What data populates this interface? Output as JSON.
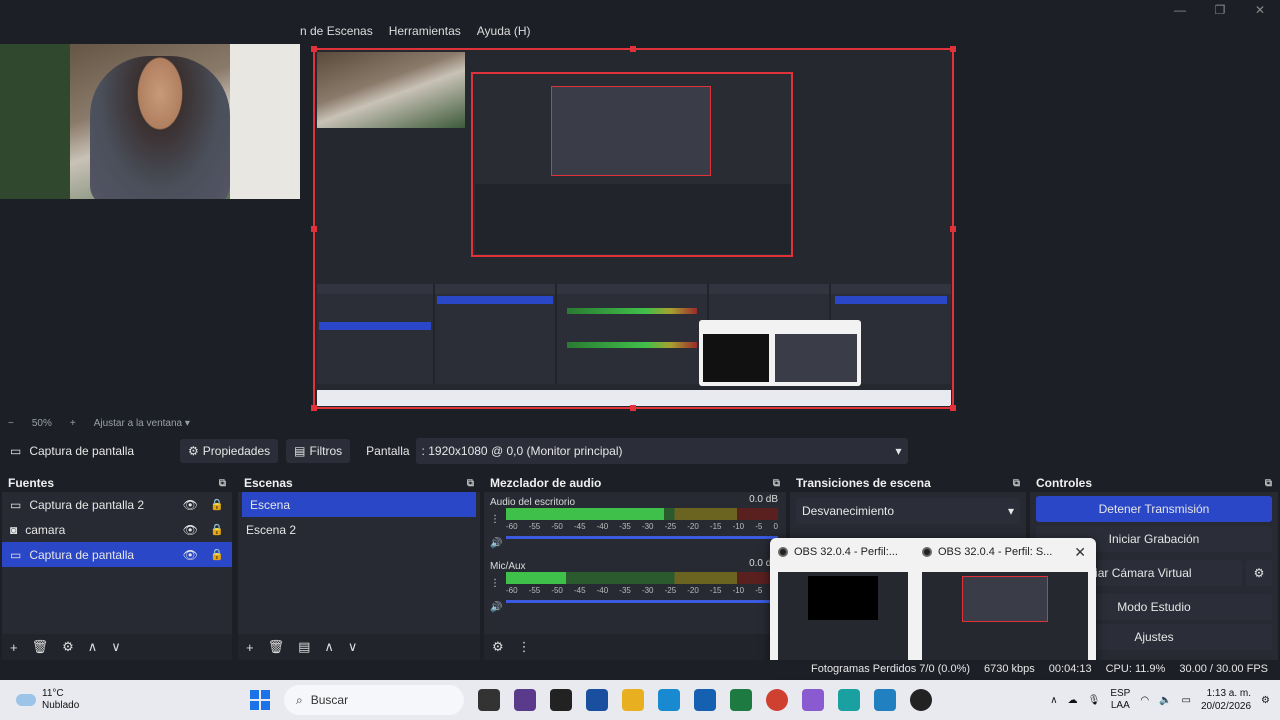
{
  "menu": {
    "items": [
      "n de Escenas",
      "Herramientas",
      "Ayuda (H)"
    ]
  },
  "window": {
    "min": "—",
    "max": "❐",
    "close": "✕"
  },
  "zoom": {
    "minus": "−",
    "value": "50%",
    "plus": "+",
    "fit_label": "Ajustar a la ventana"
  },
  "source_bar": {
    "source_name": "Captura de pantalla",
    "properties": "Propiedades",
    "filters": "Filtros",
    "display_label": "Pantalla",
    "display_value": ": 1920x1080 @ 0,0 (Monitor principal)"
  },
  "sources": {
    "title": "Fuentes",
    "items": [
      {
        "label": "Captura de pantalla 2",
        "icon": "monitor-icon"
      },
      {
        "label": "camara",
        "icon": "camera-icon"
      },
      {
        "label": "Captura de pantalla",
        "icon": "monitor-icon"
      }
    ],
    "selected_index": 2
  },
  "scenes": {
    "title": "Escenas",
    "items": [
      "Escena",
      "Escena 2"
    ],
    "selected_index": 0
  },
  "mixer": {
    "title": "Mezclador de audio",
    "channels": [
      {
        "name": "Audio del escritorio",
        "db": "0.0 dB",
        "level": 0.58
      },
      {
        "name": "Mic/Aux",
        "db": "0.0 dB",
        "level": 0.22
      }
    ],
    "ticks": [
      "-60",
      "-55",
      "-50",
      "-45",
      "-40",
      "-35",
      "-30",
      "-25",
      "-20",
      "-15",
      "-10",
      "-5",
      "0"
    ]
  },
  "transitions": {
    "title": "Transiciones de escena",
    "selected": "Desvanecimiento"
  },
  "controls": {
    "title": "Controles",
    "stop_stream": "Detener Transmisión",
    "start_recording": "Iniciar Grabación",
    "virtual_cam": "iciar Cámara Virtual",
    "studio_mode": "Modo Estudio",
    "settings": "Ajustes"
  },
  "popup": {
    "title1": "OBS 32.0.4 - Perfil:...",
    "title2": "OBS 32.0.4 - Perfil: S..."
  },
  "status": {
    "frames": "Fotogramas Perdidos 7/0 (0.0%)",
    "kbps": "6730 kbps",
    "time": "00:04:13",
    "cpu": "CPU: 11.9%",
    "fps": "30.00 / 30.00 FPS"
  },
  "taskbar": {
    "temp": "11°C",
    "weather": "Nublado",
    "search": "Buscar",
    "lang1": "ESP",
    "lang2": "LAA",
    "time": "1:13 a. m.",
    "date": "20/02/2026"
  },
  "colors": {
    "accent": "#2a47c8",
    "selection_red": "#e0323a",
    "bg": "#1d1f26"
  }
}
